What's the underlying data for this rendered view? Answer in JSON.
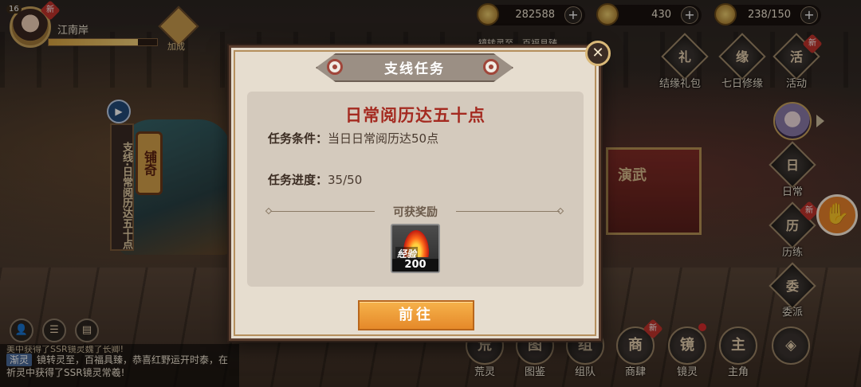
{
  "player": {
    "level": "16",
    "name": "江南岸",
    "new_badge": "新",
    "bonus_label": "加成"
  },
  "currencies": [
    {
      "icon": "coin-icon",
      "amount": "282588"
    },
    {
      "icon": "gem-icon",
      "amount": "430"
    },
    {
      "icon": "stamina-icon",
      "amount": "238/150"
    }
  ],
  "marquee": "镜转灵至，百福具臻，",
  "right_menu": [
    {
      "label": "结缘礼包",
      "glyph": "礼"
    },
    {
      "label": "七日修缘",
      "glyph": "缘"
    },
    {
      "label": "活动",
      "glyph": "活"
    },
    {
      "label": "日常",
      "glyph": "日"
    },
    {
      "label": "历练",
      "glyph": "历"
    },
    {
      "label": "委派",
      "glyph": "委"
    }
  ],
  "bottom_menu": [
    {
      "label": "荒灵",
      "glyph": "荒"
    },
    {
      "label": "图鉴",
      "glyph": "图"
    },
    {
      "label": "组队",
      "glyph": "组"
    },
    {
      "label": "商肆",
      "glyph": "商"
    },
    {
      "label": "镜灵",
      "glyph": "镜"
    },
    {
      "label": "主角",
      "glyph": "主"
    },
    {
      "label": "",
      "glyph": "◈"
    }
  ],
  "left_quest_banner": "支线·日常阅历达五十点",
  "background_signs": {
    "lamp": "铺奇",
    "stall": "演武"
  },
  "chat": {
    "top_line": "美中获得了SSR镜灵魏了长卿!",
    "tag": "渐灵",
    "message": "镜转灵至，百福具臻，恭喜红野运开时泰，在祈灵中获得了SSR镜灵常羲!"
  },
  "modal": {
    "title": "支线任务",
    "task_name": "日常阅历达五十点",
    "condition_label": "任务条件：",
    "condition_value": "当日日常阅历达50点",
    "progress_label": "任务进度：",
    "progress_value": "35/50",
    "reward_header": "可获奖励",
    "reward": {
      "name": "经验",
      "count": "200"
    },
    "go_button": "前往",
    "close_symbol": "✕"
  },
  "float_button_icon": "hand-icon",
  "colors": {
    "title_red": "#a42a20",
    "go_button_orange": "#e5892a",
    "modal_bg": "#e6ddcf"
  }
}
